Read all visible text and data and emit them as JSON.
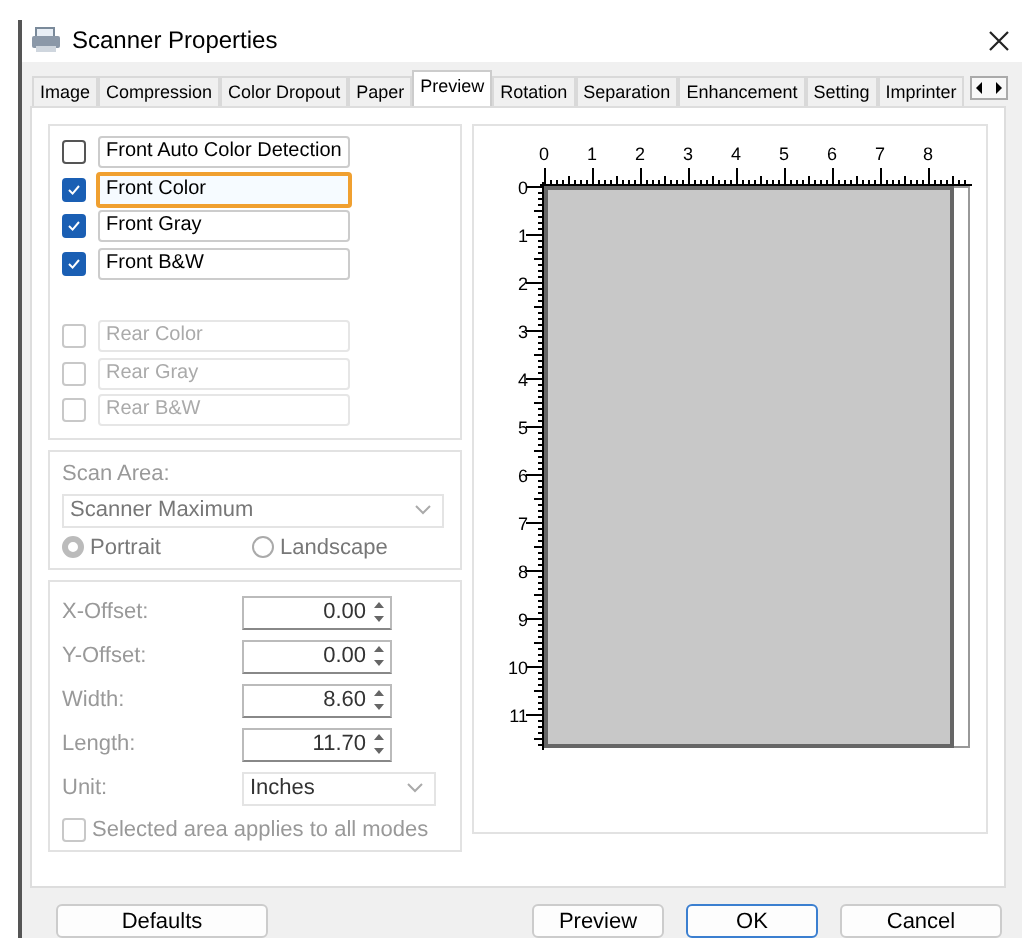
{
  "window": {
    "title": "Scanner Properties"
  },
  "tabs": [
    {
      "label": "Image",
      "selected": false
    },
    {
      "label": "Compression",
      "selected": false
    },
    {
      "label": "Color Dropout",
      "selected": false
    },
    {
      "label": "Paper",
      "selected": false
    },
    {
      "label": "Preview",
      "selected": true
    },
    {
      "label": "Rotation",
      "selected": false
    },
    {
      "label": "Separation",
      "selected": false
    },
    {
      "label": "Enhancement",
      "selected": false
    },
    {
      "label": "Setting",
      "selected": false
    },
    {
      "label": "Imprinter",
      "selected": false
    }
  ],
  "modes": [
    {
      "label": "Front Auto Color Detection",
      "checked": false,
      "disabled": false,
      "focused": false
    },
    {
      "label": "Front Color",
      "checked": true,
      "disabled": false,
      "focused": true
    },
    {
      "label": "Front Gray",
      "checked": true,
      "disabled": false,
      "focused": false
    },
    {
      "label": "Front B&W",
      "checked": true,
      "disabled": false,
      "focused": false
    },
    {
      "label": "Rear Color",
      "checked": false,
      "disabled": true,
      "focused": false
    },
    {
      "label": "Rear Gray",
      "checked": false,
      "disabled": true,
      "focused": false
    },
    {
      "label": "Rear B&W",
      "checked": false,
      "disabled": true,
      "focused": false
    }
  ],
  "scan_area": {
    "label": "Scan Area:",
    "value": "Scanner Maximum",
    "orientations": [
      {
        "label": "Portrait",
        "selected": true
      },
      {
        "label": "Landscape",
        "selected": false
      }
    ]
  },
  "offsets": [
    {
      "label": "X-Offset:",
      "value": "0.00"
    },
    {
      "label": "Y-Offset:",
      "value": "0.00"
    },
    {
      "label": "Width:",
      "value": "8.60"
    },
    {
      "label": "Length:",
      "value": "11.70"
    }
  ],
  "unit": {
    "label": "Unit:",
    "value": "Inches"
  },
  "apply_all": {
    "label": "Selected area applies to all modes",
    "checked": false
  },
  "ruler": {
    "x_labels": [
      "0",
      "1",
      "2",
      "3",
      "4",
      "5",
      "6",
      "7",
      "8"
    ],
    "y_labels": [
      "0",
      "1",
      "2",
      "3",
      "4",
      "5",
      "6",
      "7",
      "8",
      "9",
      "10",
      "11"
    ]
  },
  "buttons": [
    {
      "label": "Defaults",
      "default": false
    },
    {
      "label": "Preview",
      "default": false
    },
    {
      "label": "OK",
      "default": true
    },
    {
      "label": "Cancel",
      "default": false
    }
  ]
}
